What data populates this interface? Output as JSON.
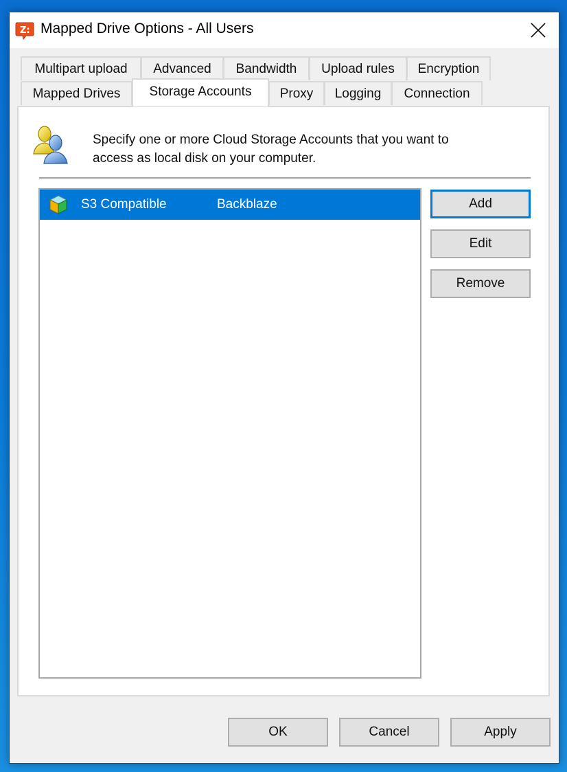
{
  "window": {
    "title": "Mapped Drive Options - All Users",
    "app_icon": "zoolz-z-icon",
    "close_icon": "close-icon"
  },
  "tabs": {
    "row1": [
      {
        "label": "Multipart upload"
      },
      {
        "label": "Advanced"
      },
      {
        "label": "Bandwidth"
      },
      {
        "label": "Upload rules"
      },
      {
        "label": "Encryption"
      }
    ],
    "row2": [
      {
        "label": "Mapped Drives"
      },
      {
        "label": "Storage Accounts",
        "active": true
      },
      {
        "label": "Proxy"
      },
      {
        "label": "Logging"
      },
      {
        "label": "Connection"
      }
    ]
  },
  "panel": {
    "icon": "users-icon",
    "description_line1": "Specify one or more Cloud Storage Accounts that you want to",
    "description_line2": "access as local disk on your computer.",
    "accounts": [
      {
        "icon": "cube-icon",
        "type": "S3 Compatible",
        "name": "Backblaze",
        "selected": true
      }
    ],
    "buttons": {
      "add": "Add",
      "edit": "Edit",
      "remove": "Remove"
    }
  },
  "footer": {
    "ok": "OK",
    "cancel": "Cancel",
    "apply": "Apply"
  },
  "colors": {
    "selection": "#0078d7",
    "accent_border": "#0078d7",
    "app_icon": "#e8501e"
  }
}
